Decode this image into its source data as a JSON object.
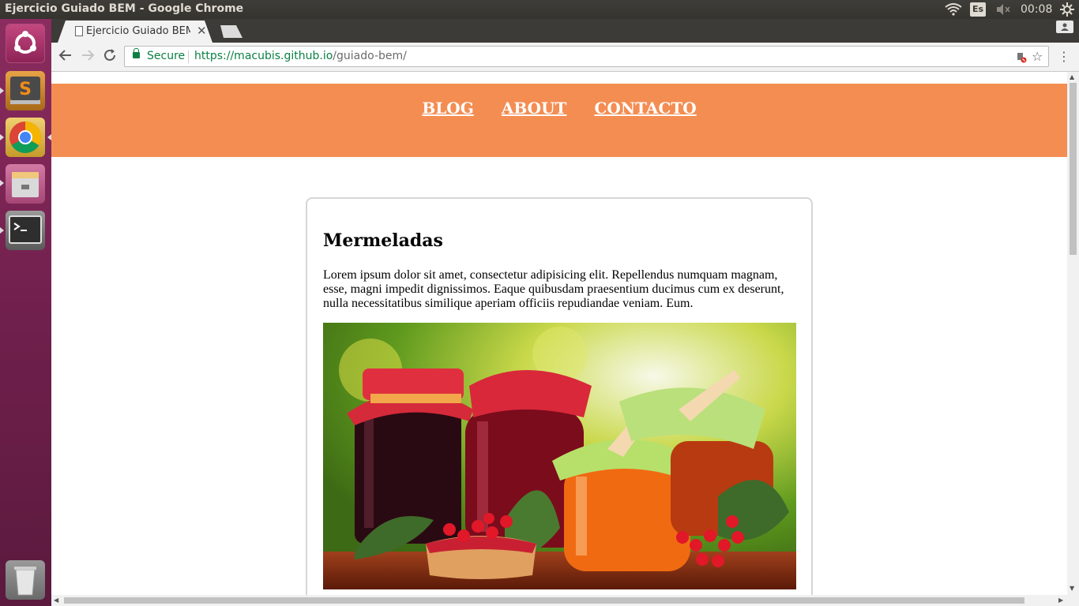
{
  "window": {
    "title": "Ejercicio Guiado BEM - Google Chrome"
  },
  "tray": {
    "keyboard_layout": "Es",
    "clock": "00:08"
  },
  "launcher": {
    "items": [
      "ubuntu-dash",
      "sublime-text",
      "chrome",
      "files",
      "terminal",
      "trash"
    ]
  },
  "browser": {
    "tab_title": "Ejercicio Guiado BEM",
    "secure_label": "Secure",
    "url_host": "https://macubis.github.io",
    "url_path": "/guiado-bem/"
  },
  "page": {
    "nav": [
      {
        "label": "BLOG"
      },
      {
        "label": "ABOUT"
      },
      {
        "label": "CONTACTO"
      }
    ],
    "card": {
      "title": "Mermeladas",
      "text": "Lorem ipsum dolor sit amet, consectetur adipisicing elit. Repellendus numquam magnam, esse, magni impedit dignissimos. Eaque quibusdam praesentium ducimus cum ex deserunt, nulla necessitatibus similique aperiam officiis repudiandae veniam. Eum."
    }
  },
  "colors": {
    "header_bg": "#f48d52",
    "secure_green": "#0b8043",
    "launcher": "#7a2552"
  }
}
